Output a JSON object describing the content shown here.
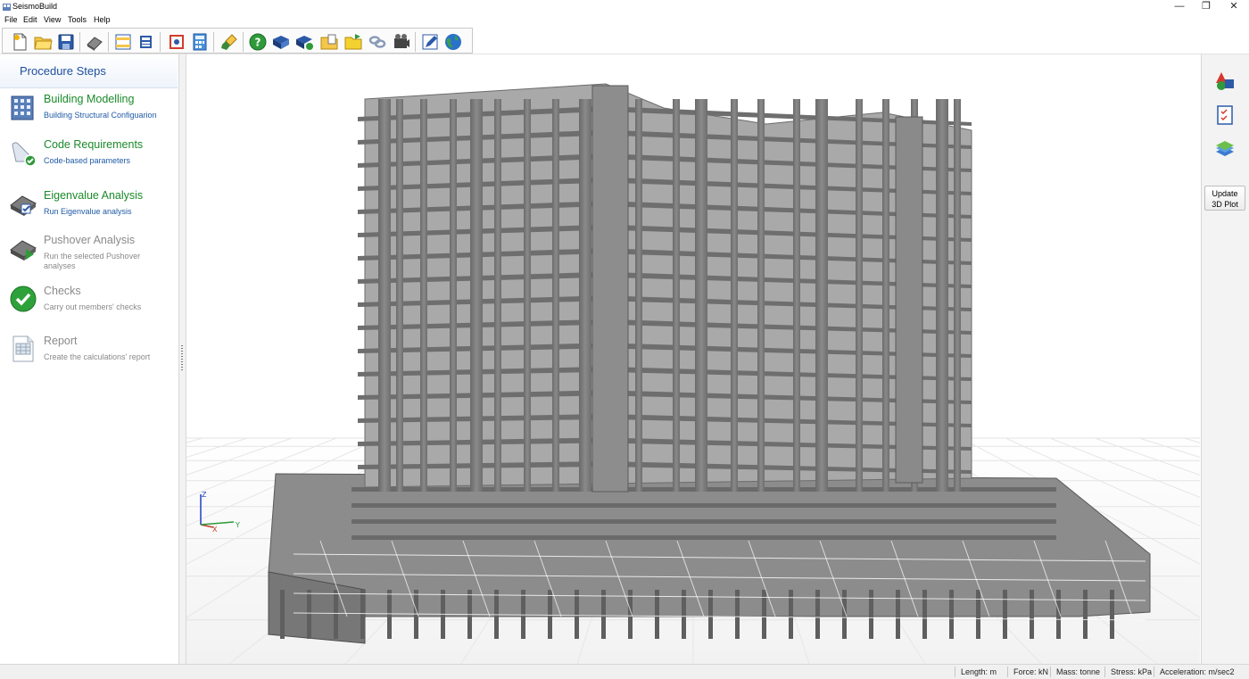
{
  "window": {
    "title": "SeismoBuild",
    "minimize": "—",
    "restore": "❐",
    "close": "✕"
  },
  "menu": [
    "File",
    "Edit",
    "View",
    "Tools",
    "Help"
  ],
  "toolbar": {
    "buttons": [
      {
        "name": "new-file-icon"
      },
      {
        "name": "open-folder-icon"
      },
      {
        "name": "save-icon"
      },
      {
        "name": "settings-icon"
      },
      {
        "name": "layout-icon"
      },
      {
        "name": "print-icon"
      },
      {
        "name": "building-model-icon"
      },
      {
        "name": "calculator-icon"
      },
      {
        "name": "brush-icon"
      },
      {
        "name": "help-icon"
      },
      {
        "name": "manual-icon"
      },
      {
        "name": "tutorial-icon"
      },
      {
        "name": "folder-docs-icon"
      },
      {
        "name": "folder-samples-icon"
      },
      {
        "name": "chain-icon"
      },
      {
        "name": "video-icon"
      },
      {
        "name": "edit-icon"
      },
      {
        "name": "globe-icon"
      }
    ]
  },
  "procedure": {
    "title": "Procedure Steps",
    "steps": [
      {
        "name": "Building Modelling",
        "desc": "Building Structural Configuarion",
        "icon": "building-icon",
        "state": "active"
      },
      {
        "name": "Code Requirements",
        "desc": "Code-based parameters",
        "icon": "code-requirements-icon",
        "state": "active"
      },
      {
        "name": "Eigenvalue Analysis",
        "desc": "Run Eigenvalue analysis",
        "icon": "eigenvalue-icon",
        "state": "active"
      },
      {
        "name": "Pushover Analysis",
        "desc": "Run the selected Pushover analyses",
        "icon": "pushover-icon",
        "state": "inactive"
      },
      {
        "name": "Checks",
        "desc": "Carry out members' checks",
        "icon": "checkmark-icon",
        "state": "inactive"
      },
      {
        "name": "Report",
        "desc": "Create the calculations' report",
        "icon": "report-icon",
        "state": "inactive"
      }
    ]
  },
  "axes": {
    "z": "Z",
    "x": "X",
    "y": "Y"
  },
  "rightpanel": {
    "icons": [
      "shapes-icon",
      "checklist-icon",
      "layers-icon"
    ],
    "update_line1": "Update",
    "update_line2": "3D Plot"
  },
  "status": {
    "length": "Length: m",
    "force": "Force: kN",
    "mass": "Mass: tonne",
    "stress": "Stress: kPa",
    "acceleration": "Acceleration: m/sec2"
  },
  "model": {
    "floors": 16,
    "base_levels": 4
  }
}
